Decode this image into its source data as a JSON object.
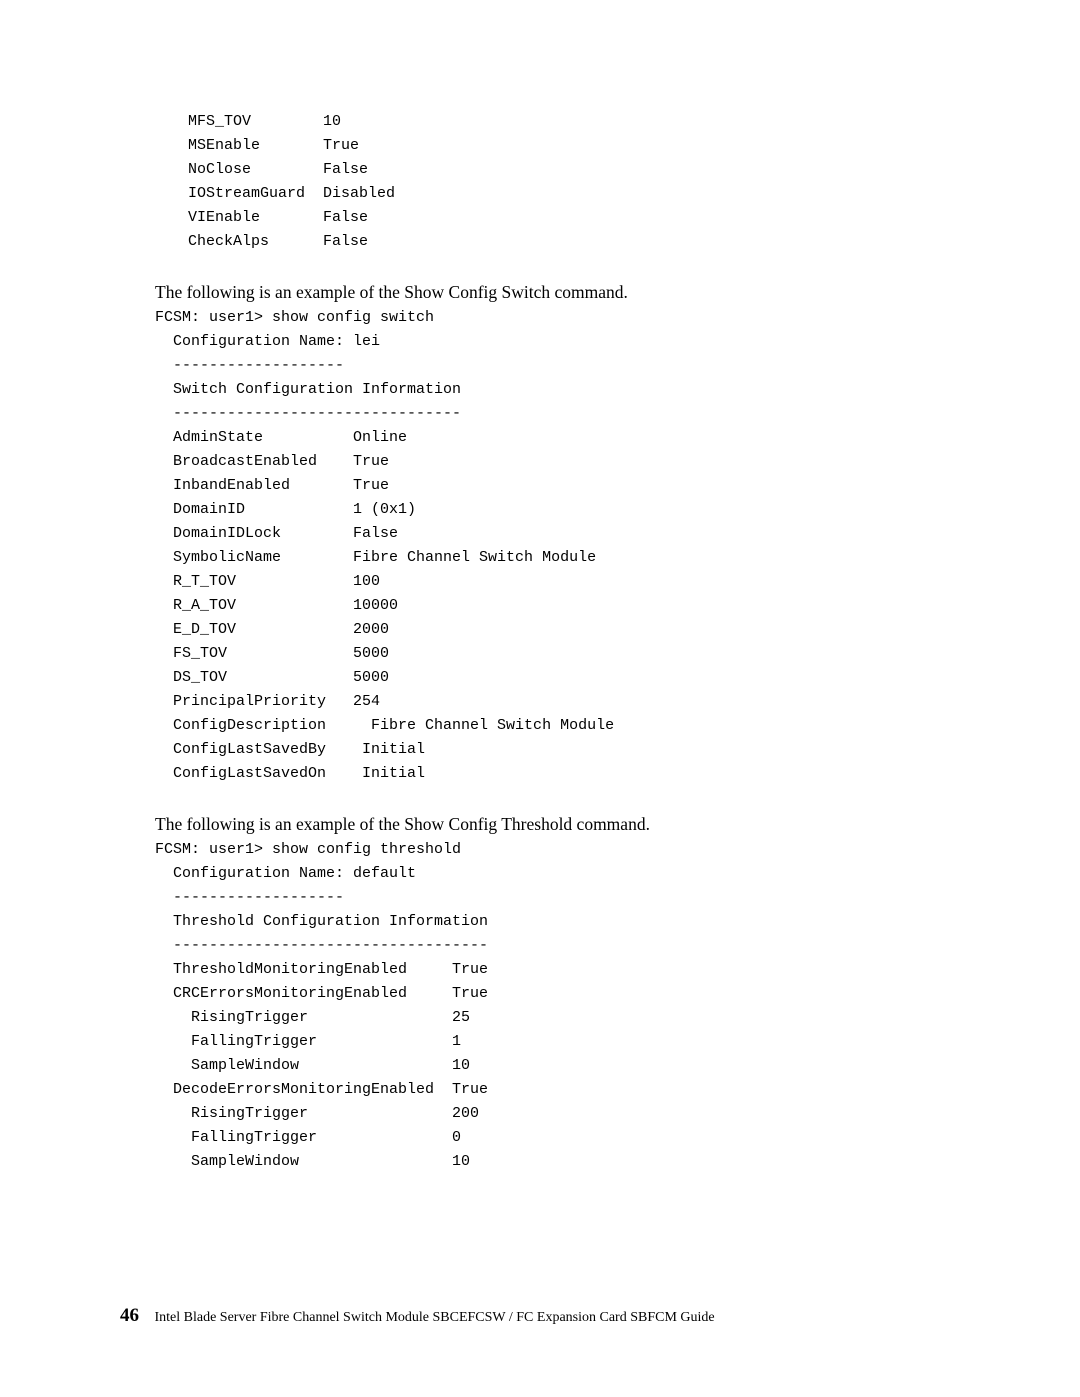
{
  "block1": "  MFS_TOV        10\n  MSEnable       True\n  NoClose        False\n  IOStreamGuard  Disabled\n  VIEnable       False\n  CheckAlps      False",
  "prose1": "The following is an example of the Show Config Switch command.",
  "block2": "FCSM: user1> show config switch\n  Configuration Name: lei\n  -------------------\n  Switch Configuration Information\n  --------------------------------\n  AdminState          Online\n  BroadcastEnabled    True\n  InbandEnabled       True\n  DomainID            1 (0x1)\n  DomainIDLock        False\n  SymbolicName        Fibre Channel Switch Module\n  R_T_TOV             100\n  R_A_TOV             10000\n  E_D_TOV             2000\n  FS_TOV              5000\n  DS_TOV              5000\n  PrincipalPriority   254\n  ConfigDescription     Fibre Channel Switch Module\n  ConfigLastSavedBy    Initial\n  ConfigLastSavedOn    Initial",
  "prose2": "The following is an example of the Show Config Threshold command.",
  "block3": "FCSM: user1> show config threshold\n  Configuration Name: default\n  -------------------\n  Threshold Configuration Information\n  -----------------------------------\n  ThresholdMonitoringEnabled     True\n  CRCErrorsMonitoringEnabled     True\n    RisingTrigger                25\n    FallingTrigger               1\n    SampleWindow                 10\n  DecodeErrorsMonitoringEnabled  True\n    RisingTrigger                200\n    FallingTrigger               0\n    SampleWindow                 10",
  "footer": {
    "page": "46",
    "title": "Intel Blade Server Fibre Channel Switch Module SBCEFCSW / FC Expansion Card SBFCM Guide"
  }
}
